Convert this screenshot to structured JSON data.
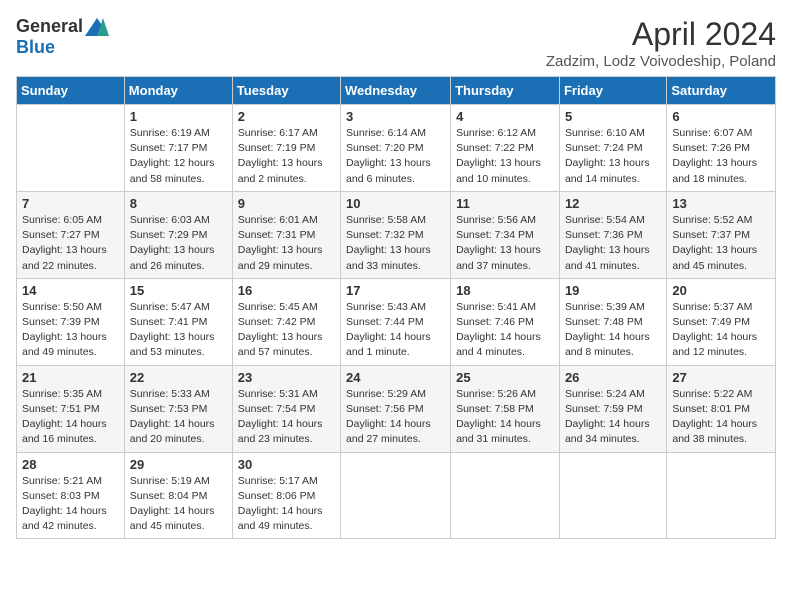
{
  "header": {
    "logo_general": "General",
    "logo_blue": "Blue",
    "month_title": "April 2024",
    "location": "Zadzim, Lodz Voivodeship, Poland"
  },
  "weekdays": [
    "Sunday",
    "Monday",
    "Tuesday",
    "Wednesday",
    "Thursday",
    "Friday",
    "Saturday"
  ],
  "weeks": [
    [
      {
        "day": "",
        "content": ""
      },
      {
        "day": "1",
        "content": "Sunrise: 6:19 AM\nSunset: 7:17 PM\nDaylight: 12 hours\nand 58 minutes."
      },
      {
        "day": "2",
        "content": "Sunrise: 6:17 AM\nSunset: 7:19 PM\nDaylight: 13 hours\nand 2 minutes."
      },
      {
        "day": "3",
        "content": "Sunrise: 6:14 AM\nSunset: 7:20 PM\nDaylight: 13 hours\nand 6 minutes."
      },
      {
        "day": "4",
        "content": "Sunrise: 6:12 AM\nSunset: 7:22 PM\nDaylight: 13 hours\nand 10 minutes."
      },
      {
        "day": "5",
        "content": "Sunrise: 6:10 AM\nSunset: 7:24 PM\nDaylight: 13 hours\nand 14 minutes."
      },
      {
        "day": "6",
        "content": "Sunrise: 6:07 AM\nSunset: 7:26 PM\nDaylight: 13 hours\nand 18 minutes."
      }
    ],
    [
      {
        "day": "7",
        "content": "Sunrise: 6:05 AM\nSunset: 7:27 PM\nDaylight: 13 hours\nand 22 minutes."
      },
      {
        "day": "8",
        "content": "Sunrise: 6:03 AM\nSunset: 7:29 PM\nDaylight: 13 hours\nand 26 minutes."
      },
      {
        "day": "9",
        "content": "Sunrise: 6:01 AM\nSunset: 7:31 PM\nDaylight: 13 hours\nand 29 minutes."
      },
      {
        "day": "10",
        "content": "Sunrise: 5:58 AM\nSunset: 7:32 PM\nDaylight: 13 hours\nand 33 minutes."
      },
      {
        "day": "11",
        "content": "Sunrise: 5:56 AM\nSunset: 7:34 PM\nDaylight: 13 hours\nand 37 minutes."
      },
      {
        "day": "12",
        "content": "Sunrise: 5:54 AM\nSunset: 7:36 PM\nDaylight: 13 hours\nand 41 minutes."
      },
      {
        "day": "13",
        "content": "Sunrise: 5:52 AM\nSunset: 7:37 PM\nDaylight: 13 hours\nand 45 minutes."
      }
    ],
    [
      {
        "day": "14",
        "content": "Sunrise: 5:50 AM\nSunset: 7:39 PM\nDaylight: 13 hours\nand 49 minutes."
      },
      {
        "day": "15",
        "content": "Sunrise: 5:47 AM\nSunset: 7:41 PM\nDaylight: 13 hours\nand 53 minutes."
      },
      {
        "day": "16",
        "content": "Sunrise: 5:45 AM\nSunset: 7:42 PM\nDaylight: 13 hours\nand 57 minutes."
      },
      {
        "day": "17",
        "content": "Sunrise: 5:43 AM\nSunset: 7:44 PM\nDaylight: 14 hours\nand 1 minute."
      },
      {
        "day": "18",
        "content": "Sunrise: 5:41 AM\nSunset: 7:46 PM\nDaylight: 14 hours\nand 4 minutes."
      },
      {
        "day": "19",
        "content": "Sunrise: 5:39 AM\nSunset: 7:48 PM\nDaylight: 14 hours\nand 8 minutes."
      },
      {
        "day": "20",
        "content": "Sunrise: 5:37 AM\nSunset: 7:49 PM\nDaylight: 14 hours\nand 12 minutes."
      }
    ],
    [
      {
        "day": "21",
        "content": "Sunrise: 5:35 AM\nSunset: 7:51 PM\nDaylight: 14 hours\nand 16 minutes."
      },
      {
        "day": "22",
        "content": "Sunrise: 5:33 AM\nSunset: 7:53 PM\nDaylight: 14 hours\nand 20 minutes."
      },
      {
        "day": "23",
        "content": "Sunrise: 5:31 AM\nSunset: 7:54 PM\nDaylight: 14 hours\nand 23 minutes."
      },
      {
        "day": "24",
        "content": "Sunrise: 5:29 AM\nSunset: 7:56 PM\nDaylight: 14 hours\nand 27 minutes."
      },
      {
        "day": "25",
        "content": "Sunrise: 5:26 AM\nSunset: 7:58 PM\nDaylight: 14 hours\nand 31 minutes."
      },
      {
        "day": "26",
        "content": "Sunrise: 5:24 AM\nSunset: 7:59 PM\nDaylight: 14 hours\nand 34 minutes."
      },
      {
        "day": "27",
        "content": "Sunrise: 5:22 AM\nSunset: 8:01 PM\nDaylight: 14 hours\nand 38 minutes."
      }
    ],
    [
      {
        "day": "28",
        "content": "Sunrise: 5:21 AM\nSunset: 8:03 PM\nDaylight: 14 hours\nand 42 minutes."
      },
      {
        "day": "29",
        "content": "Sunrise: 5:19 AM\nSunset: 8:04 PM\nDaylight: 14 hours\nand 45 minutes."
      },
      {
        "day": "30",
        "content": "Sunrise: 5:17 AM\nSunset: 8:06 PM\nDaylight: 14 hours\nand 49 minutes."
      },
      {
        "day": "",
        "content": ""
      },
      {
        "day": "",
        "content": ""
      },
      {
        "day": "",
        "content": ""
      },
      {
        "day": "",
        "content": ""
      }
    ]
  ]
}
